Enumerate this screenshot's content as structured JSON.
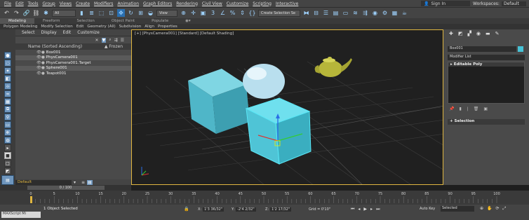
{
  "menubar": {
    "items": [
      "File",
      "Edit",
      "Tools",
      "Group",
      "Views",
      "Create",
      "Modifiers",
      "Animation",
      "Graph Editors",
      "Rendering",
      "Civil View",
      "Customize",
      "Scripting",
      "Interactive"
    ],
    "signin": "Sign In",
    "workspaces_label": "Workspaces:",
    "workspaces_value": "Default"
  },
  "toolbar": {
    "filter_dropdown": "All",
    "view_dropdown": "View",
    "selection_set": "Create Selection Se",
    "snap_label": "3",
    "accent": "#6fbdf2"
  },
  "ribbon_tabs": [
    "Modeling",
    "Freeform",
    "Selection",
    "Object Paint",
    "Populate"
  ],
  "ribbon_active": "Modeling",
  "ribbon_sub": [
    "Polygon Modeling",
    "Modify Selection",
    "Edit",
    "Geometry (All)",
    "Subdivision",
    "Align",
    "Properties"
  ],
  "scene_explorer": {
    "menu": [
      "Select",
      "Display",
      "Edit",
      "Customize"
    ],
    "column_name": "Name (Sorted Ascending)",
    "column_frozen": "▲ Frozen",
    "objects": [
      {
        "name": "Box001",
        "selected": false
      },
      {
        "name": "PhysCamera001",
        "selected": true
      },
      {
        "name": "PhysCamera001.Target",
        "selected": false
      },
      {
        "name": "Sphere001",
        "selected": true
      },
      {
        "name": "Teapot001",
        "selected": false
      }
    ],
    "layer": "Default"
  },
  "time_slider": {
    "frames": "0 / 100"
  },
  "viewport": {
    "label": "[+] [PhysCamera001] [Standard] [Default Shading]",
    "border_color": "#e0b640"
  },
  "command_panel": {
    "object_name": "Box001",
    "object_color": "#46c2d6",
    "modifier_list": "Modifier List",
    "stack": [
      "Editable Poly"
    ],
    "rollout": "Selection"
  },
  "timeline": {
    "ticks": [
      "0",
      "5",
      "10",
      "15",
      "20",
      "25",
      "30",
      "35",
      "40",
      "45",
      "50",
      "55",
      "60",
      "65",
      "70",
      "75",
      "80",
      "85",
      "90",
      "95",
      "100"
    ]
  },
  "status": {
    "objects_selected": "1 Object Selected",
    "x_label": "X:",
    "x_value": "1'3 36/32\"",
    "y_label": "Y:",
    "y_value": "-2'4 2/32\"",
    "z_label": "Z:",
    "z_value": "1'2 17/32\"",
    "grid": "Grid = 0'10\"",
    "autokey": "Auto Key",
    "selected_dropdown": "Selected",
    "maxscript": "MAXScript Mi"
  }
}
